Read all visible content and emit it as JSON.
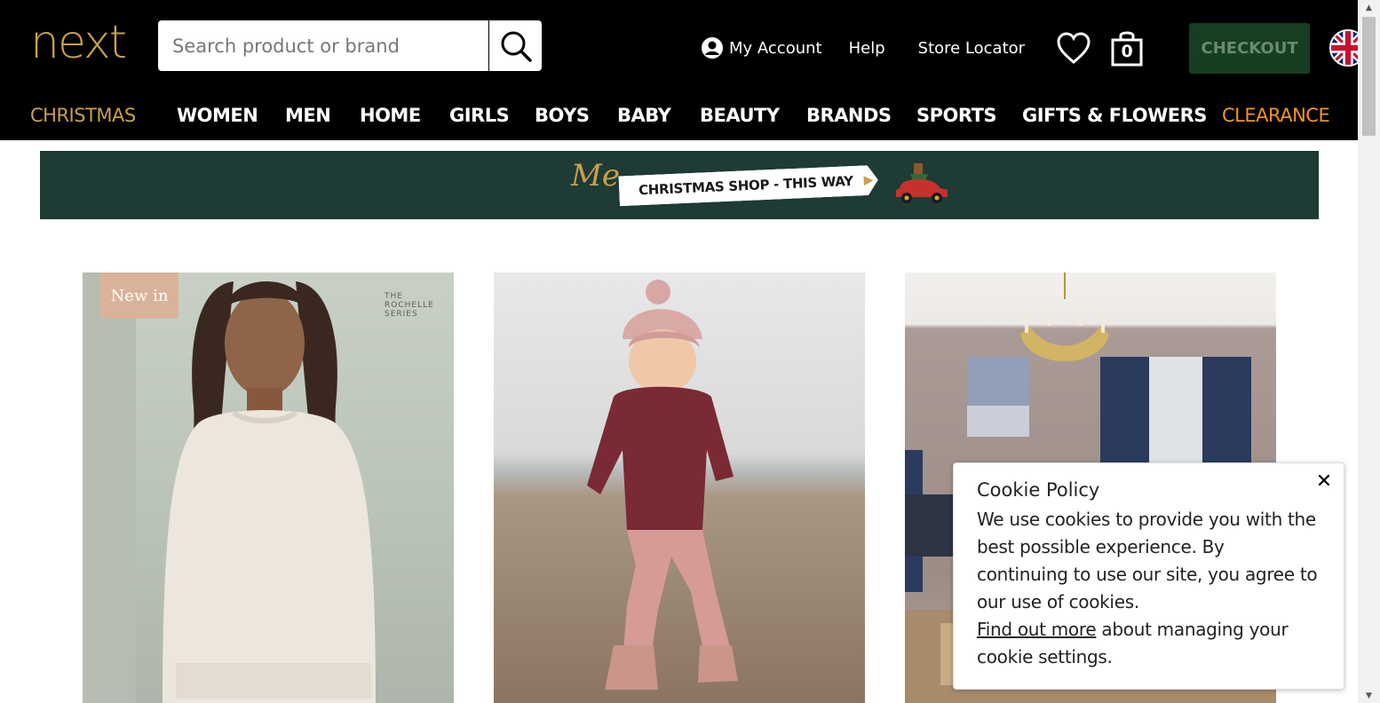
{
  "header": {
    "logo": "next",
    "search": {
      "placeholder": "Search product or brand",
      "value": ""
    },
    "links": {
      "account": "My Account",
      "help": "Help",
      "store_locator": "Store Locator"
    },
    "bag_count": "0",
    "checkout_label": "CHECKOUT"
  },
  "nav": {
    "items": [
      {
        "label": "CHRISTMAS",
        "style": "gold"
      },
      {
        "label": "WOMEN",
        "style": "white"
      },
      {
        "label": "MEN",
        "style": "white"
      },
      {
        "label": "HOME",
        "style": "white"
      },
      {
        "label": "GIRLS",
        "style": "white"
      },
      {
        "label": "BOYS",
        "style": "white"
      },
      {
        "label": "BABY",
        "style": "white"
      },
      {
        "label": "BEAUTY",
        "style": "white"
      },
      {
        "label": "BRANDS",
        "style": "white"
      },
      {
        "label": "SPORTS",
        "style": "white"
      },
      {
        "label": "GIFTS & FLOWERS",
        "style": "white"
      },
      {
        "label": "CLEARANCE",
        "style": "orange"
      }
    ]
  },
  "banner": {
    "script_text": "Me",
    "ribbon_text": "CHRISTMAS SHOP - THIS WAY",
    "arrow": "▶"
  },
  "tiles": {
    "women": {
      "badge": "New in",
      "series": [
        "THE",
        "ROCHELLE",
        "SERIES"
      ]
    },
    "baby": {},
    "home": {}
  },
  "cookie": {
    "title": "Cookie Policy",
    "body": "We use cookies to provide you with the best possible experience. By continuing to use our site, you agree to our use of cookies.",
    "link": "Find out more",
    "tail": " about managing your cookie settings.",
    "close": "✕"
  },
  "colors": {
    "header_bg": "#000000",
    "gold": "#c9a04a",
    "clearance": "#f39325",
    "checkout_bg": "#163e20",
    "banner_bg": "#1e3b36"
  },
  "icons": {
    "search": "search-icon",
    "account": "user-circle-icon",
    "wishlist": "heart-icon",
    "bag": "shopping-bag-icon",
    "country": "uk-flag-icon",
    "close": "close-icon"
  }
}
